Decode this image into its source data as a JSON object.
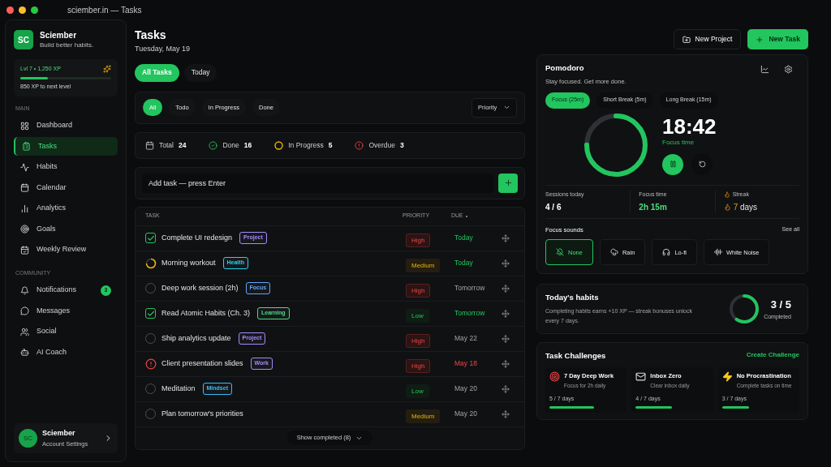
{
  "window": {
    "title": "sciember.in — Tasks"
  },
  "brand": {
    "logo": "SC",
    "name": "Sciember",
    "tagline": "Build better habits."
  },
  "xp": {
    "label": "Lvl 7 • 1,250 XP",
    "level": 0.3,
    "note": "850 XP to next level"
  },
  "nav_sections": [
    {
      "heading": "MAIN",
      "items": [
        {
          "label": "Dashboard",
          "selected": false
        },
        {
          "label": "Tasks",
          "selected": true
        },
        {
          "label": "Habits",
          "selected": false
        },
        {
          "label": "Calendar",
          "selected": false
        },
        {
          "label": "Analytics",
          "selected": false
        },
        {
          "label": "Goals",
          "selected": false
        },
        {
          "label": "Weekly Review",
          "selected": false
        }
      ]
    },
    {
      "heading": "COMMUNITY",
      "items": [
        {
          "label": "Notifications",
          "selected": false,
          "badge": "3"
        },
        {
          "label": "Messages",
          "selected": false
        },
        {
          "label": "Social",
          "selected": false
        },
        {
          "label": "AI Coach",
          "selected": false
        }
      ]
    }
  ],
  "account": {
    "avatar": "SC",
    "name": "Sciember",
    "subtitle": "Account Settings"
  },
  "page": {
    "title": "Tasks",
    "date": "Tuesday, May 19"
  },
  "header_buttons": [
    {
      "label": "New Project",
      "kind": "secondary"
    },
    {
      "label": "New Task",
      "kind": "primary"
    }
  ],
  "view_tabs": [
    {
      "label": "All Tasks",
      "selected": true
    },
    {
      "label": "Today",
      "selected": false
    }
  ],
  "filters": [
    {
      "label": "All",
      "selected": true
    },
    {
      "label": "Todo",
      "selected": false
    },
    {
      "label": "In Progress",
      "selected": false
    },
    {
      "label": "Done",
      "selected": false
    }
  ],
  "sort": {
    "value": "Priority"
  },
  "stats": [
    {
      "kind": "total",
      "label": "Total",
      "value": "24"
    },
    {
      "kind": "done",
      "label": "Done",
      "value": "16"
    },
    {
      "kind": "progress",
      "label": "In Progress",
      "value": "5"
    },
    {
      "kind": "overdue",
      "label": "Overdue",
      "value": "3"
    }
  ],
  "add_task": {
    "placeholder": "Add task — press Enter"
  },
  "table": {
    "columns": [
      "TASK",
      "PRIORITY",
      "DUE"
    ],
    "rows": [
      {
        "kind": "done",
        "title": "Complete UI redesign",
        "tag": {
          "label": "Project",
          "color": "#a78bfa"
        },
        "priority": {
          "label": "High",
          "kind": "high"
        },
        "due": {
          "text": "Today",
          "kind": "soon"
        }
      },
      {
        "kind": "progress",
        "title": "Morning workout",
        "tag": {
          "label": "Health",
          "color": "#22d3ee"
        },
        "priority": {
          "label": "Medium",
          "kind": "medium"
        },
        "due": {
          "text": "Today",
          "kind": "soon"
        }
      },
      {
        "kind": "todo",
        "title": "Deep work session (2h)",
        "tag": {
          "label": "Focus",
          "color": "#60a5fa"
        },
        "priority": {
          "label": "High",
          "kind": "high"
        },
        "due": {
          "text": "Tomorrow",
          "kind": "plain"
        }
      },
      {
        "kind": "done",
        "title": "Read Atomic Habits (Ch. 3)",
        "tag": {
          "label": "Learning",
          "color": "#4ade80"
        },
        "priority": {
          "label": "Low",
          "kind": "low"
        },
        "due": {
          "text": "Tomorrow",
          "kind": "soon"
        }
      },
      {
        "kind": "todo",
        "title": "Ship analytics update",
        "tag": {
          "label": "Project",
          "color": "#a78bfa"
        },
        "priority": {
          "label": "High",
          "kind": "high"
        },
        "due": {
          "text": "May 22",
          "kind": "plain"
        }
      },
      {
        "kind": "overdue",
        "title": "Client presentation slides",
        "tag": {
          "label": "Work",
          "color": "#a78bfa"
        },
        "priority": {
          "label": "High",
          "kind": "high"
        },
        "due": {
          "text": "May 18",
          "kind": "overdue"
        }
      },
      {
        "kind": "todo",
        "title": "Meditation",
        "tag": {
          "label": "Mindset",
          "color": "#38bdf8"
        },
        "priority": {
          "label": "Low",
          "kind": "low"
        },
        "due": {
          "text": "May 20",
          "kind": "plain"
        }
      },
      {
        "kind": "todo",
        "title": "Plan tomorrow's priorities",
        "priority": {
          "label": "Medium",
          "kind": "medium"
        },
        "due": {
          "text": "May 20",
          "kind": "plain"
        }
      }
    ],
    "footer": "Show completed (8)"
  },
  "pomodoro": {
    "title": "Pomodoro",
    "subtitle": "Stay focused. Get more done.",
    "modes": [
      {
        "label": "Focus (25m)",
        "selected": true
      },
      {
        "label": "Short Break (5m)",
        "selected": false
      },
      {
        "label": "Long Break (15m)",
        "selected": false
      }
    ],
    "level": 0.75,
    "time": "18:42",
    "caption": "Focus time",
    "stats": [
      {
        "label": "Sessions today",
        "value": "4 / 6",
        "kind": "plain"
      },
      {
        "label": "Focus time",
        "value": "2h 15m",
        "kind": "accent"
      },
      {
        "label": "Streak",
        "value_number": "7",
        "value": "days",
        "kind": "streak"
      }
    ],
    "sounds_title": "Focus sounds",
    "see_all": "See all",
    "sounds": [
      {
        "label": "None",
        "selected": true
      },
      {
        "label": "Rain",
        "selected": false
      },
      {
        "label": "Lo-fi",
        "selected": false
      },
      {
        "label": "White Noise",
        "selected": false
      }
    ]
  },
  "habits": {
    "title": "Today's habits",
    "text": "Completing habits earns +10 XP — streak bonuses unlock every 7 days.",
    "value": "3 / 5",
    "caption": "Completed"
  },
  "challenges": {
    "title": "Task Challenges",
    "action": "Create Challenge",
    "items": [
      {
        "title": "7 Day Deep Work",
        "subtitle": "Focus for 2h daily",
        "progress": "5 / 7 days",
        "level": 0.71
      },
      {
        "title": "Inbox Zero",
        "subtitle": "Clear inbox daily",
        "progress": "4 / 7 days",
        "level": 0.57
      },
      {
        "title": "No Procrastination",
        "subtitle": "Complete tasks on time",
        "progress": "3 / 7 days",
        "level": 0.43
      }
    ]
  }
}
